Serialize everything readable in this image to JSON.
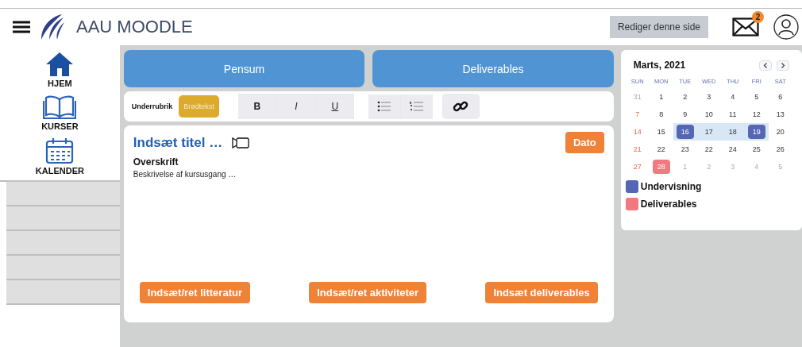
{
  "header": {
    "title": "AAU MOODLE",
    "edit_button": "Rediger denne side",
    "mail_badge": "2"
  },
  "sidebar": {
    "items": [
      {
        "label": "HJEM"
      },
      {
        "label": "KURSER"
      },
      {
        "label": "KALENDER"
      }
    ]
  },
  "tabs": [
    {
      "label": "Pensum"
    },
    {
      "label": "Deliverables"
    }
  ],
  "toolbar": {
    "styles": [
      {
        "label": "Underrubrik",
        "selected": false
      },
      {
        "label": "Brødtekst",
        "selected": true
      }
    ],
    "format": [
      {
        "label": "B",
        "kind": "bold"
      },
      {
        "label": "I",
        "kind": "italic"
      },
      {
        "label": "U",
        "kind": "underline"
      }
    ],
    "lists": [
      {
        "kind": "bullet"
      },
      {
        "kind": "numbered"
      }
    ]
  },
  "editor": {
    "title": "Indsæt titel …",
    "date_button": "Dato",
    "heading": "Overskrift",
    "description": "Beskrivelse af kursusgang …",
    "buttons": [
      "Indsæt/ret litteratur",
      "Indsæt/ret aktiviteter",
      "Indsæt deliverables"
    ]
  },
  "calendar": {
    "month": "Marts, 2021",
    "weekdays": [
      "SUN",
      "MON",
      "TUE",
      "WED",
      "THU",
      "FRI",
      "SAT"
    ],
    "days": [
      {
        "label": "31",
        "kind": "muted"
      },
      {
        "label": "1",
        "kind": "normal"
      },
      {
        "label": "2",
        "kind": "normal"
      },
      {
        "label": "3",
        "kind": "normal"
      },
      {
        "label": "4",
        "kind": "normal"
      },
      {
        "label": "5",
        "kind": "normal"
      },
      {
        "label": "6",
        "kind": "normal"
      },
      {
        "label": "7",
        "kind": "sunday"
      },
      {
        "label": "8",
        "kind": "normal"
      },
      {
        "label": "9",
        "kind": "normal"
      },
      {
        "label": "10",
        "kind": "normal"
      },
      {
        "label": "11",
        "kind": "normal"
      },
      {
        "label": "12",
        "kind": "normal"
      },
      {
        "label": "13",
        "kind": "normal"
      },
      {
        "label": "14",
        "kind": "sunday"
      },
      {
        "label": "15",
        "kind": "normal"
      },
      {
        "label": "16",
        "kind": "teaching"
      },
      {
        "label": "17",
        "kind": "range"
      },
      {
        "label": "18",
        "kind": "range"
      },
      {
        "label": "19",
        "kind": "teaching"
      },
      {
        "label": "20",
        "kind": "normal"
      },
      {
        "label": "21",
        "kind": "sunday"
      },
      {
        "label": "22",
        "kind": "normal"
      },
      {
        "label": "23",
        "kind": "normal"
      },
      {
        "label": "22",
        "kind": "normal"
      },
      {
        "label": "24",
        "kind": "normal"
      },
      {
        "label": "25",
        "kind": "normal"
      },
      {
        "label": "26",
        "kind": "normal"
      },
      {
        "label": "27",
        "kind": "sunday"
      },
      {
        "label": "28",
        "kind": "deliverable"
      },
      {
        "label": "1",
        "kind": "muted"
      },
      {
        "label": "2",
        "kind": "muted"
      },
      {
        "label": "3",
        "kind": "muted"
      },
      {
        "label": "4",
        "kind": "muted"
      },
      {
        "label": "5",
        "kind": "muted"
      }
    ],
    "legend": [
      {
        "label": "Undervisning",
        "color": "#5566b4"
      },
      {
        "label": "Deliverables",
        "color": "#f07a80"
      }
    ]
  }
}
